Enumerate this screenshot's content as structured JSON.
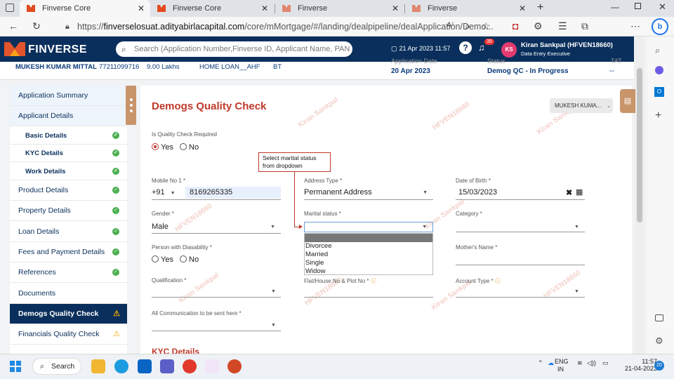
{
  "browser": {
    "tabs": [
      {
        "title": "Finverse Core",
        "active": true
      },
      {
        "title": "Finverse Core",
        "active": false
      },
      {
        "title": "Finverse",
        "active": false
      },
      {
        "title": "Finverse",
        "active": false
      }
    ],
    "url_prefix": "https://",
    "url_host": "finverselosuat.adityabirlacapital.com",
    "url_path": "/core/mMortgage/#/landing/dealpipeline/dealApplication/Demo..."
  },
  "app": {
    "brand": "FINVERSE",
    "search_placeholder": "Search (Application Number,Finverse ID, Applicant Name, PAN Number)",
    "date": "21 Apr 2023 11:57",
    "notif_count": "39",
    "avatar": "KS",
    "user_name": "Kiran Sankpal (HFVEN18660)",
    "user_role": "Data Entry Executive"
  },
  "summary": {
    "name": "MUKESH KUMAR MITTAL",
    "phone": "77211099716",
    "amount": "9.00 Lakhs",
    "product": "HOME LOAN__AHF",
    "type": "BT",
    "app_date_label": "Application Date",
    "app_date": "20 Apr 2023",
    "status_label": "Status",
    "status": "Demog QC - In Progress",
    "tat_label": "TAT",
    "tat": "--"
  },
  "leftnav": [
    {
      "label": "Application Summary",
      "kind": "sec",
      "state": ""
    },
    {
      "label": "Applicant Details",
      "kind": "sec",
      "state": ""
    },
    {
      "label": "Basic Details",
      "kind": "sub",
      "state": "ok"
    },
    {
      "label": "KYC Details",
      "kind": "sub",
      "state": "ok"
    },
    {
      "label": "Work Details",
      "kind": "sub",
      "state": "ok"
    },
    {
      "label": "Product Details",
      "kind": "main",
      "state": "ok"
    },
    {
      "label": "Property Details",
      "kind": "main",
      "state": "ok"
    },
    {
      "label": "Loan Details",
      "kind": "main",
      "state": "ok"
    },
    {
      "label": "Fees and Payment Details",
      "kind": "main",
      "state": "ok"
    },
    {
      "label": "References",
      "kind": "main",
      "state": "ok"
    },
    {
      "label": "Documents",
      "kind": "main",
      "state": ""
    },
    {
      "label": "Demogs Quality Check",
      "kind": "active",
      "state": "warn"
    },
    {
      "label": "Financials Quality Check",
      "kind": "main",
      "state": "warn"
    }
  ],
  "form": {
    "title": "Demogs Quality Check",
    "user_button": "MUKESH KUMA...",
    "qc_required_label": "Is Quality Check Required",
    "yes": "Yes",
    "no": "No",
    "mobile_label": "Mobile No 1 *",
    "mobile_cc": "+91",
    "mobile_value": "8169265335",
    "address_type_label": "Address Type *",
    "address_type_value": "Permanent Address",
    "dob_label": "Date of Birth *",
    "dob_value": "15/03/2023",
    "gender_label": "Gender *",
    "gender_value": "Male",
    "marital_label": "Marital status *",
    "category_label": "Category *",
    "disability_label": "Person with Diasability *",
    "mother_label": "Mother's Name *",
    "qualification_label": "Qualification *",
    "flat_label": "Flat/House No & Plot No *",
    "account_type_label": "Account Type *",
    "comm_label": "All Communication to be sent here *",
    "marital_options": [
      "Divorcee",
      "Married",
      "Single",
      "Widow"
    ],
    "kyc_title": "KYC Details"
  },
  "callout": "Select marital status from dropdown",
  "watermark": [
    "Kiran Sankpal",
    "HFVEN18660"
  ],
  "taskbar": {
    "search": "Search",
    "lang1": "ENG",
    "lang2": "IN",
    "time": "11:57",
    "date": "21-04-2023",
    "notif": "20"
  }
}
